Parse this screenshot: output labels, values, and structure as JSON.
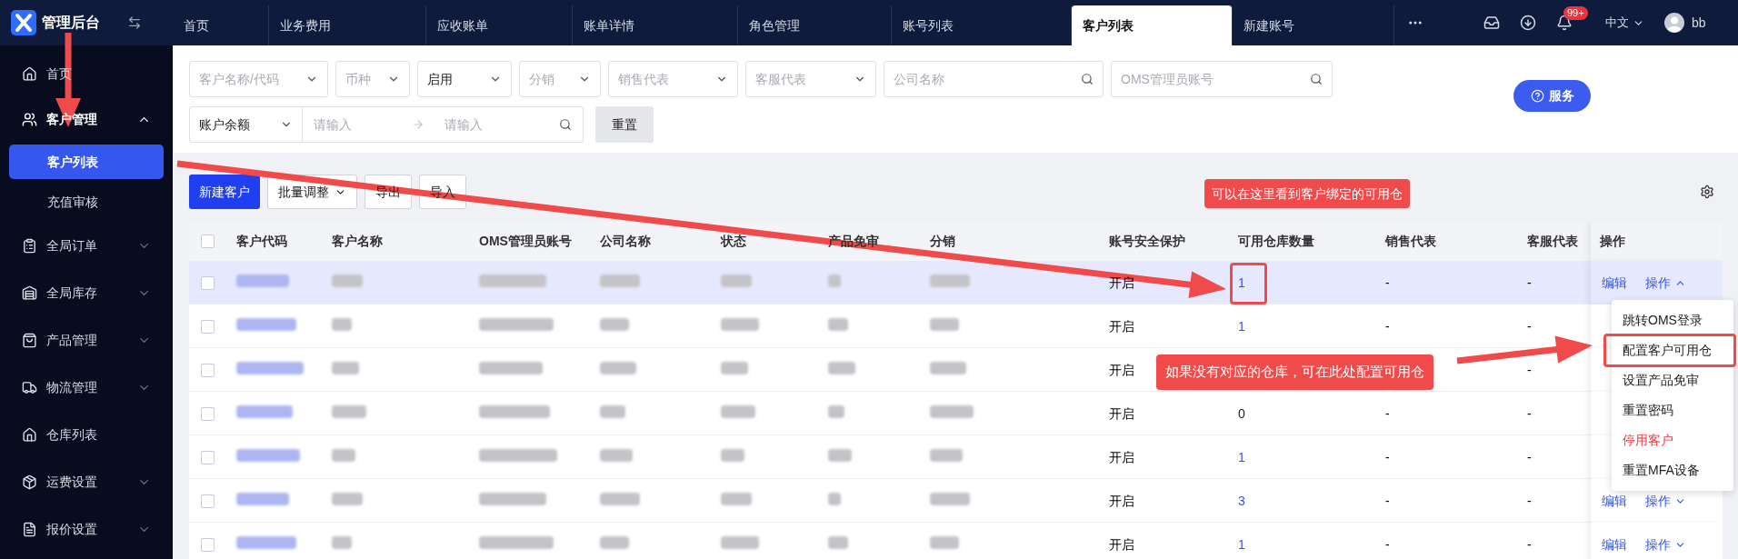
{
  "app": {
    "title": "管理后台"
  },
  "tabs": [
    {
      "label": "首页",
      "selected": false
    },
    {
      "label": "业务费用",
      "selected": false
    },
    {
      "label": "应收账单",
      "selected": false
    },
    {
      "label": "账单详情",
      "selected": false
    },
    {
      "label": "角色管理",
      "selected": false
    },
    {
      "label": "账号列表",
      "selected": false
    },
    {
      "label": "客户列表",
      "selected": true
    },
    {
      "label": "新建账号",
      "selected": false
    }
  ],
  "header": {
    "notification_badge": "99+",
    "language": "中文",
    "user": "bb"
  },
  "sidebar": [
    {
      "kind": "link",
      "label": "首页"
    },
    {
      "kind": "group",
      "label": "客户管理",
      "expanded": true,
      "children": [
        {
          "label": "客户列表",
          "selected": true
        },
        {
          "label": "充值审核",
          "selected": false
        }
      ]
    },
    {
      "kind": "group",
      "label": "全局订单",
      "expanded": false
    },
    {
      "kind": "group",
      "label": "全局库存",
      "expanded": false
    },
    {
      "kind": "group",
      "label": "产品管理",
      "expanded": false
    },
    {
      "kind": "group",
      "label": "物流管理",
      "expanded": false
    },
    {
      "kind": "link",
      "label": "仓库列表"
    },
    {
      "kind": "group",
      "label": "运费设置",
      "expanded": false
    },
    {
      "kind": "group",
      "label": "报价设置",
      "expanded": false
    }
  ],
  "filters": [
    {
      "kind": "select",
      "placeholder": "客户名称/代码"
    },
    {
      "kind": "select",
      "placeholder": "币种"
    },
    {
      "kind": "select",
      "value": "启用"
    },
    {
      "kind": "select",
      "placeholder": "分销"
    },
    {
      "kind": "select",
      "placeholder": "销售代表"
    },
    {
      "kind": "select",
      "placeholder": "客服代表"
    },
    {
      "kind": "search",
      "placeholder": "公司名称"
    },
    {
      "kind": "search",
      "placeholder": "OMS管理员账号"
    }
  ],
  "range_filter": {
    "select": "账户余额",
    "from_placeholder": "请输入",
    "to_placeholder": "请输入"
  },
  "reset_button": "重置",
  "service_button": "服务",
  "toolbar": [
    {
      "kind": "primary",
      "label": "新建客户"
    },
    {
      "kind": "dropdown",
      "label": "批量调整"
    },
    {
      "kind": "plain",
      "label": "导出"
    },
    {
      "kind": "plain",
      "label": "导入"
    }
  ],
  "table": {
    "select_all": {
      "checked": false
    },
    "columns": [
      "客户代码",
      "客户名称",
      "OMS管理员账号",
      "公司名称",
      "状态",
      "产品免审",
      "分销",
      "账号安全保护",
      "可用仓库数量",
      "销售代表",
      "客服代表",
      "操作"
    ],
    "rows": [
      {
        "selected": true,
        "checked": false,
        "security": "开启",
        "warehouses": {
          "text": "1",
          "linked": true
        },
        "sales": "-",
        "service": "-",
        "actions": {
          "edit": "编辑",
          "more": "操作",
          "expanded": true
        }
      },
      {
        "selected": false,
        "checked": false,
        "security": "开启",
        "warehouses": {
          "text": "1",
          "linked": true
        },
        "sales": "-",
        "service": "-"
      },
      {
        "selected": false,
        "checked": false,
        "security": "开启",
        "service": "-"
      },
      {
        "selected": false,
        "checked": false,
        "security": "开启",
        "warehouses": {
          "text": "0",
          "linked": false
        },
        "sales": "-",
        "service": "-"
      },
      {
        "selected": false,
        "checked": false,
        "security": "开启",
        "warehouses": {
          "text": "1",
          "linked": true
        },
        "sales": "-",
        "service": "-"
      },
      {
        "selected": false,
        "checked": false,
        "security": "开启",
        "warehouses": {
          "text": "3",
          "linked": true
        },
        "sales": "-",
        "service": "-",
        "actions": {
          "edit": "编辑",
          "more": "操作",
          "expanded": false
        }
      },
      {
        "selected": false,
        "checked": false,
        "security": "开启",
        "warehouses": {
          "text": "1",
          "linked": true
        },
        "sales": "-",
        "service": "-",
        "actions": {
          "edit": "编辑",
          "more": "操作",
          "expanded": false
        }
      }
    ]
  },
  "action_menu": [
    {
      "label": "跳转OMS登录",
      "danger": false,
      "highlighted": false
    },
    {
      "label": "配置客户可用仓",
      "danger": false,
      "highlighted": true
    },
    {
      "label": "设置产品免审",
      "danger": false,
      "highlighted": false
    },
    {
      "label": "重置密码",
      "danger": false,
      "highlighted": false
    },
    {
      "label": "停用客户",
      "danger": true,
      "highlighted": false
    },
    {
      "label": "重置MFA设备",
      "danger": false,
      "highlighted": false
    }
  ],
  "annotations": [
    {
      "text": "可以在这里看到客户绑定的可用仓"
    },
    {
      "text": "如果没有对应的仓库，可在此处配置可用仓"
    }
  ]
}
